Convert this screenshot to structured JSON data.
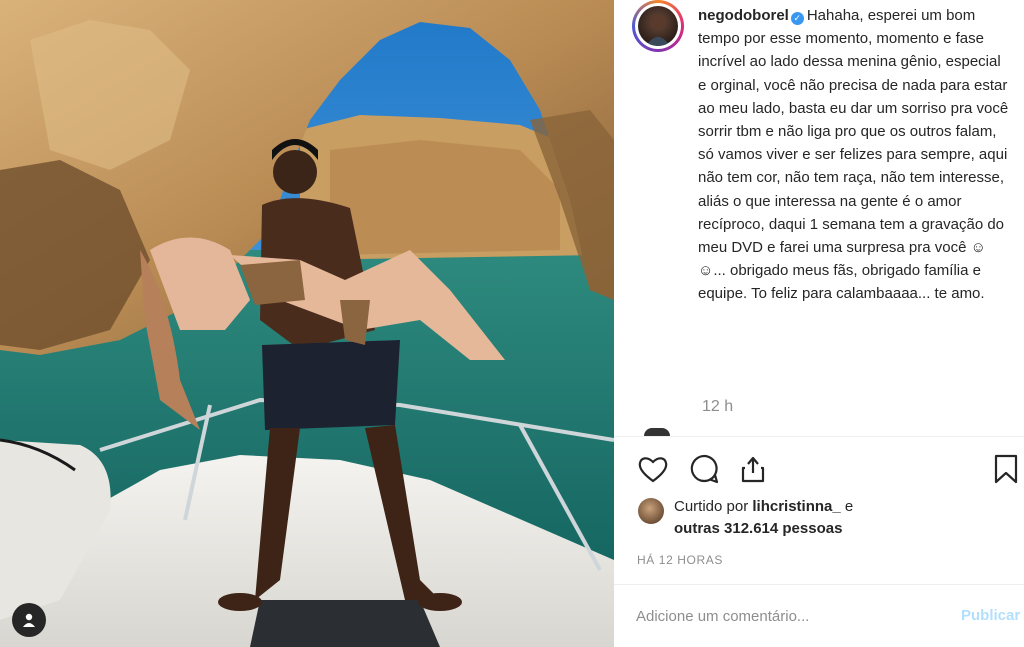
{
  "post": {
    "username": "negodoborel",
    "caption": "Hahaha, esperei um bom tempo por esse momento, momento e fase incrível ao lado dessa menina gênio, especial e orginal, você não precisa de nada para estar ao meu lado, basta eu dar um sorriso pra você sorrir tbm e não liga pro que os outros falam, só vamos viver e ser felizes para sempre, aqui não tem cor, não tem raça, não tem interesse, aliás o que interessa na gente é o amor recíproco, daqui 1 semana tem a gravação do meu DVD e farei uma surpresa pra você ☺☺... obrigado meus fãs, obrigado família e equipe. To feliz para calambaaaa... te amo.",
    "time_ago": "12 h"
  },
  "likes": {
    "prefix": "Curtido por",
    "user": "lihcristinna_",
    "conj": "e",
    "others": "outras 312.614 pessoas"
  },
  "timestamp": "HÁ 12 HORAS",
  "comment": {
    "placeholder": "Adicione um comentário...",
    "publish_label": "Publicar"
  },
  "colors": {
    "text": "#262626",
    "muted": "#8e8e8e",
    "verified": "#3897f0",
    "publish_disabled": "#b2dffc"
  },
  "icons": {
    "verified": "verified-badge-icon",
    "like": "heart-icon",
    "comment": "comment-icon",
    "share": "share-icon",
    "save": "bookmark-icon",
    "tag": "user-tag-icon"
  }
}
